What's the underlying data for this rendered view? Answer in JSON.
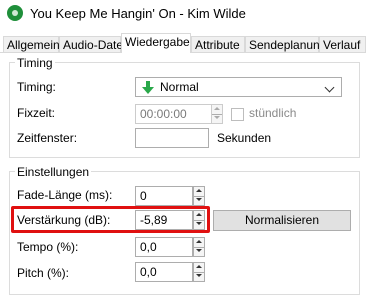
{
  "window": {
    "title": "You Keep Me Hangin' On - Kim Wilde"
  },
  "tabs": [
    "Allgemein",
    "Audio-Datei",
    "Wiedergabe",
    "Attribute",
    "Sendeplanung",
    "Verlauf"
  ],
  "timing": {
    "group_title": "Timing",
    "timing_label": "Timing:",
    "timing_value": "Normal",
    "fixzeit_label": "Fixzeit:",
    "fixzeit_value": "00:00:00",
    "stuendlich_label": "stündlich",
    "zeitfenster_label": "Zeitfenster:",
    "zeitfenster_value": "",
    "sekunden_label": "Sekunden"
  },
  "settings": {
    "group_title": "Einstellungen",
    "fade_label": "Fade-Länge (ms):",
    "fade_value": "0",
    "gain_label": "Verstärkung (dB):",
    "gain_value": "-5,89",
    "normalize_label": "Normalisieren",
    "tempo_label": "Tempo (%):",
    "tempo_value": "0,0",
    "pitch_label": "Pitch (%):",
    "pitch_value": "0,0"
  },
  "colors": {
    "highlight": "#e01010",
    "accent_green": "#1f8f3a"
  }
}
